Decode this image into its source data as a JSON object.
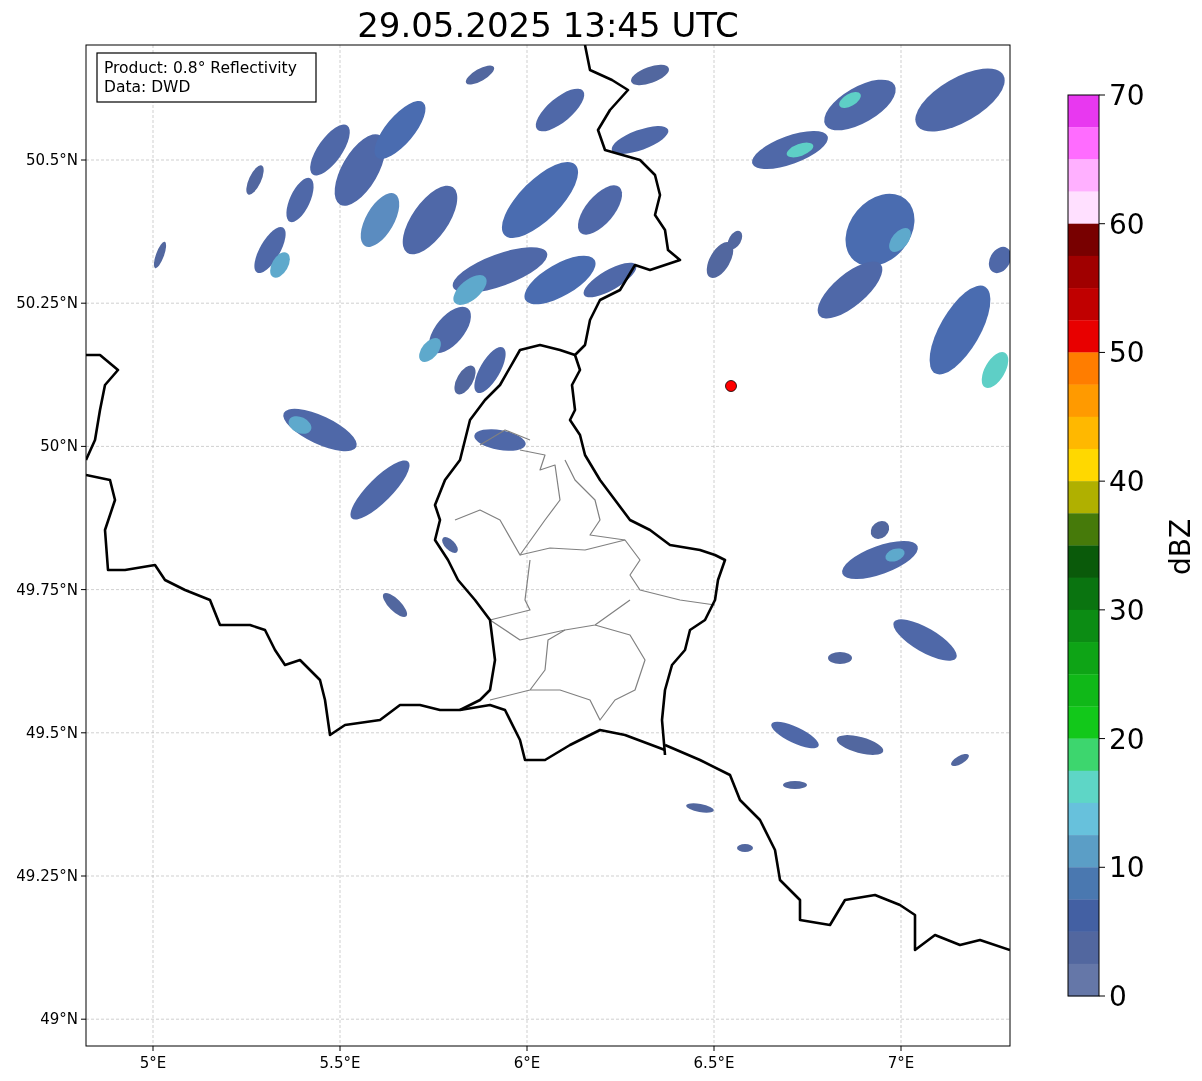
{
  "title": "29.05.2025 13:45 UTC",
  "map": {
    "info_box": [
      "Product: 0.8° Reflectivity",
      "Data: DWD"
    ],
    "xticks": [
      "5°E",
      "5.5°E",
      "6°E",
      "6.5°E",
      "7°E"
    ],
    "yticks": [
      "50.5°N",
      "50.25°N",
      "50°N",
      "49.75°N",
      "49.5°N",
      "49.25°N",
      "49°N"
    ],
    "marker": {
      "color": "#ff0000"
    }
  },
  "colorbar": {
    "label": "dBZ",
    "ticks": [
      "70",
      "60",
      "50",
      "40",
      "30",
      "20",
      "10",
      "0"
    ],
    "bins": [
      {
        "color": "#e838f0"
      },
      {
        "color": "#ff6cff"
      },
      {
        "color": "#ffb0ff"
      },
      {
        "color": "#ffe0ff"
      },
      {
        "color": "#780000"
      },
      {
        "color": "#a00000"
      },
      {
        "color": "#c00000"
      },
      {
        "color": "#e80000"
      },
      {
        "color": "#ff7d00"
      },
      {
        "color": "#ff9a00"
      },
      {
        "color": "#ffb800"
      },
      {
        "color": "#ffd800"
      },
      {
        "color": "#b0b000"
      },
      {
        "color": "#467a0a"
      },
      {
        "color": "#0a5a0a"
      },
      {
        "color": "#0a7410"
      },
      {
        "color": "#0c8c14"
      },
      {
        "color": "#0ea416"
      },
      {
        "color": "#10b818"
      },
      {
        "color": "#12c81a"
      },
      {
        "color": "#3dd66e"
      },
      {
        "color": "#5ed6c6"
      },
      {
        "color": "#67c1dc"
      },
      {
        "color": "#5b9ec6"
      },
      {
        "color": "#4a78b0"
      },
      {
        "color": "#4360a3"
      },
      {
        "color": "#52679f"
      },
      {
        "color": "#6577a8"
      }
    ]
  }
}
